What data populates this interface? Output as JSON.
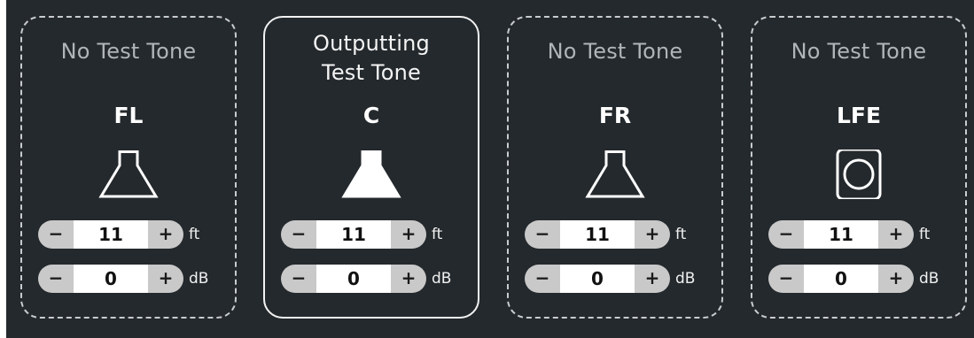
{
  "colors": {
    "panel_background": "#24292d",
    "inactive_border": "#c9cccf",
    "active_border": "#f2f2f2",
    "inactive_status_text": "#b0b5b9",
    "stepper_background": "#c9c9c9",
    "value_background": "#ffffff"
  },
  "channels": [
    {
      "status": "No Test Tone",
      "name": "FL",
      "active": false,
      "icon": "speaker-outline-icon",
      "distance": {
        "minus": "−",
        "value": "11",
        "plus": "+",
        "unit": "ft"
      },
      "gain": {
        "minus": "−",
        "value": "0",
        "plus": "+",
        "unit": "dB"
      }
    },
    {
      "status": "Outputting\nTest Tone",
      "name": "C",
      "active": true,
      "icon": "speaker-filled-icon",
      "distance": {
        "minus": "−",
        "value": "11",
        "plus": "+",
        "unit": "ft"
      },
      "gain": {
        "minus": "−",
        "value": "0",
        "plus": "+",
        "unit": "dB"
      }
    },
    {
      "status": "No Test Tone",
      "name": "FR",
      "active": false,
      "icon": "speaker-outline-icon",
      "distance": {
        "minus": "−",
        "value": "11",
        "plus": "+",
        "unit": "ft"
      },
      "gain": {
        "minus": "−",
        "value": "0",
        "plus": "+",
        "unit": "dB"
      }
    },
    {
      "status": "No Test Tone",
      "name": "LFE",
      "active": false,
      "icon": "subwoofer-icon",
      "distance": {
        "minus": "−",
        "value": "11",
        "plus": "+",
        "unit": "ft"
      },
      "gain": {
        "minus": "−",
        "value": "0",
        "plus": "+",
        "unit": "dB"
      }
    }
  ]
}
